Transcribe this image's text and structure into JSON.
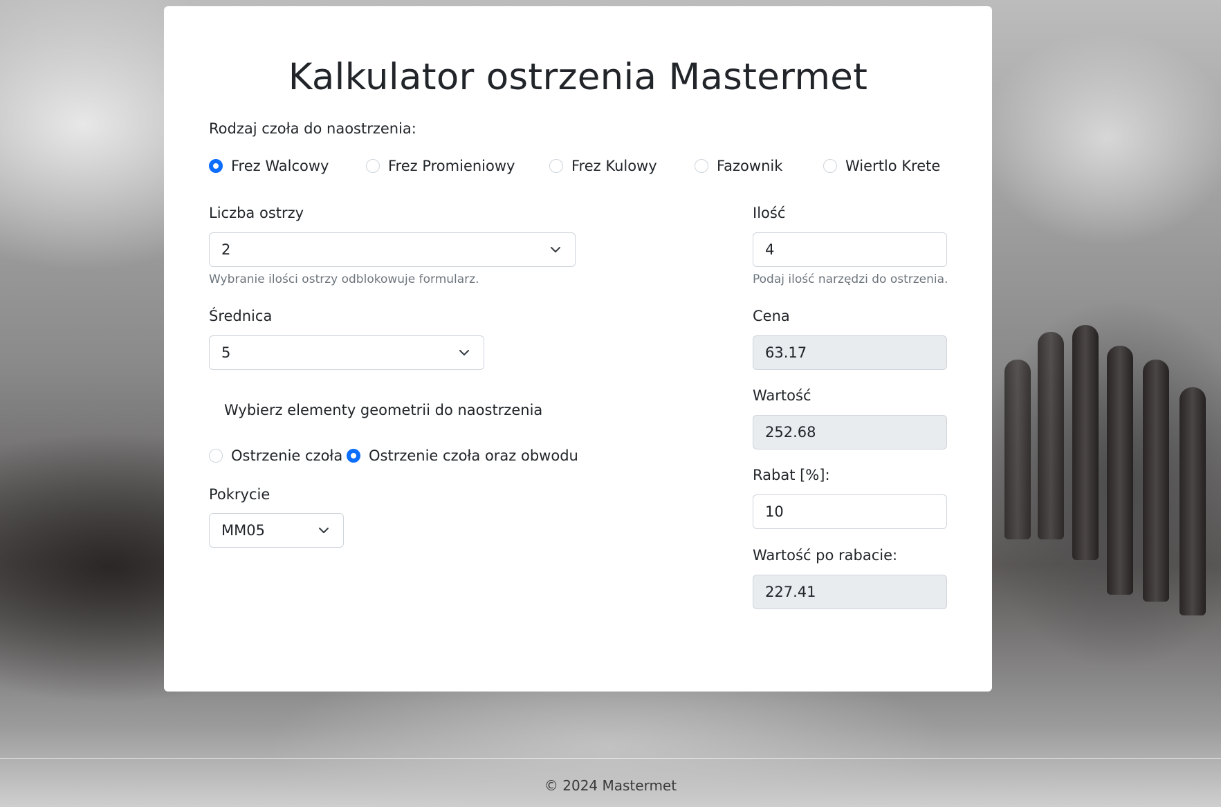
{
  "page": {
    "title": "Kalkulator ostrzenia Mastermet"
  },
  "face_type": {
    "label": "Rodzaj czoła do naostrzenia:",
    "options": [
      "Frez Walcowy",
      "Frez Promieniowy",
      "Frez Kulowy",
      "Fazownik",
      "Wiertlo Krete"
    ],
    "selected": "Frez Walcowy"
  },
  "blades": {
    "label": "Liczba ostrzy",
    "value": "2",
    "hint": "Wybranie ilości ostrzy odblokowuje formularz."
  },
  "diameter": {
    "label": "Średnica",
    "value": "5"
  },
  "geometry": {
    "label": "Wybierz elementy geometrii do naostrzenia",
    "options": [
      "Ostrzenie czoła",
      "Ostrzenie czoła oraz obwodu"
    ],
    "selected": "Ostrzenie czoła oraz obwodu"
  },
  "coating": {
    "label": "Pokrycie",
    "value": "MM05"
  },
  "quantity": {
    "label": "Ilość",
    "value": "4",
    "hint": "Podaj ilość narzędzi do ostrzenia."
  },
  "price": {
    "label": "Cena",
    "value": "63.17"
  },
  "total": {
    "label": "Wartość",
    "value": "252.68"
  },
  "discount": {
    "label": "Rabat [%]:",
    "value": "10"
  },
  "total_after_discount": {
    "label": "Wartość po rabacie:",
    "value": "227.41"
  },
  "footer": {
    "text": "© 2024 Mastermet"
  },
  "colors": {
    "accent": "#0d6efd",
    "readonly_bg": "#e9ecef"
  }
}
